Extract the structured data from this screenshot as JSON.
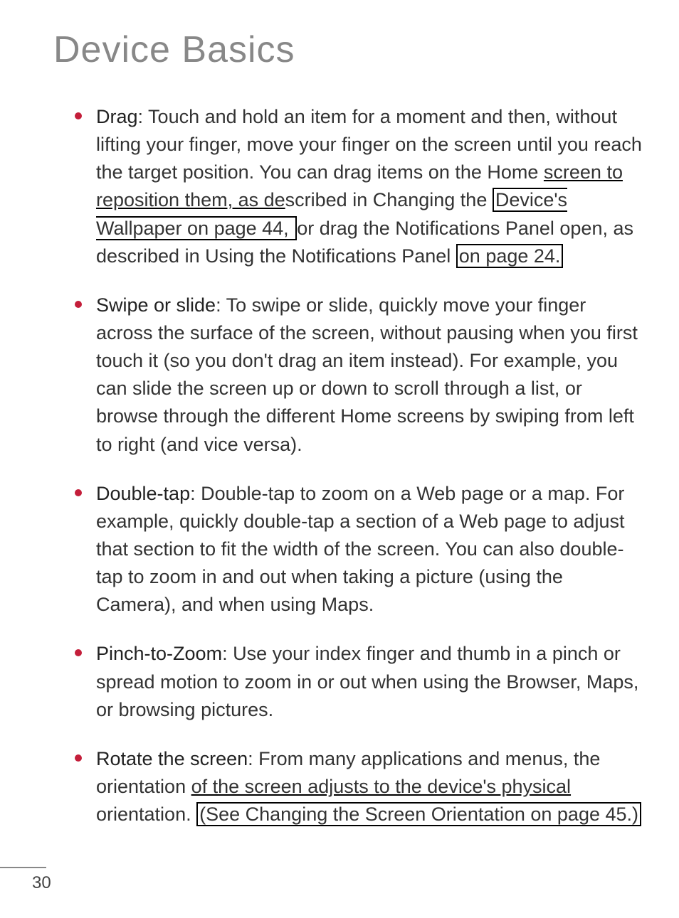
{
  "title": "Device Basics",
  "pageNumber": "30",
  "bullets": [
    {
      "term": "Drag",
      "text_before_link1": ": Touch and hold an item for a moment and then, without lifting your finger, move your finger on the screen until you reach the target position. You can drag items on the Home ",
      "link1_underline": "screen to reposition them, as de",
      "text_mid1": "scribed in Changing the ",
      "link2_box": "Device's Wallpaper on page 44, ",
      "text_mid2": "or drag the Notifications Panel open, as described in Using the Notifications Panel ",
      "link3_box": "on page 24."
    },
    {
      "term": "Swipe or slide",
      "text": ": To swipe or slide, quickly move your finger across the surface of the screen, without pausing when you first touch it (so you don't drag an item instead). For example, you can slide the screen up or down to scroll through a list, or browse through the different Home screens by swiping from left to right (and vice versa)."
    },
    {
      "term": "Double-tap",
      "text": ": Double-tap to zoom on a Web page or a map. For example, quickly double-tap a section of a Web page to adjust that section to fit the width of the screen. You can also double-tap to zoom in and out when taking a picture (using the Camera), and when using Maps."
    },
    {
      "term": "Pinch-to-Zoom",
      "text": ": Use your index finger and thumb in a pinch or spread motion to zoom in or out when using the Browser, Maps, or browsing pictures."
    },
    {
      "term": "Rotate the screen",
      "text_before": ": From many applications and menus, the orientation ",
      "underline_text": "of the screen adjusts to the device's physical",
      "text_mid": " orientation. ",
      "link_box": "(See Changing the Screen Orientation on page 45.)"
    }
  ]
}
